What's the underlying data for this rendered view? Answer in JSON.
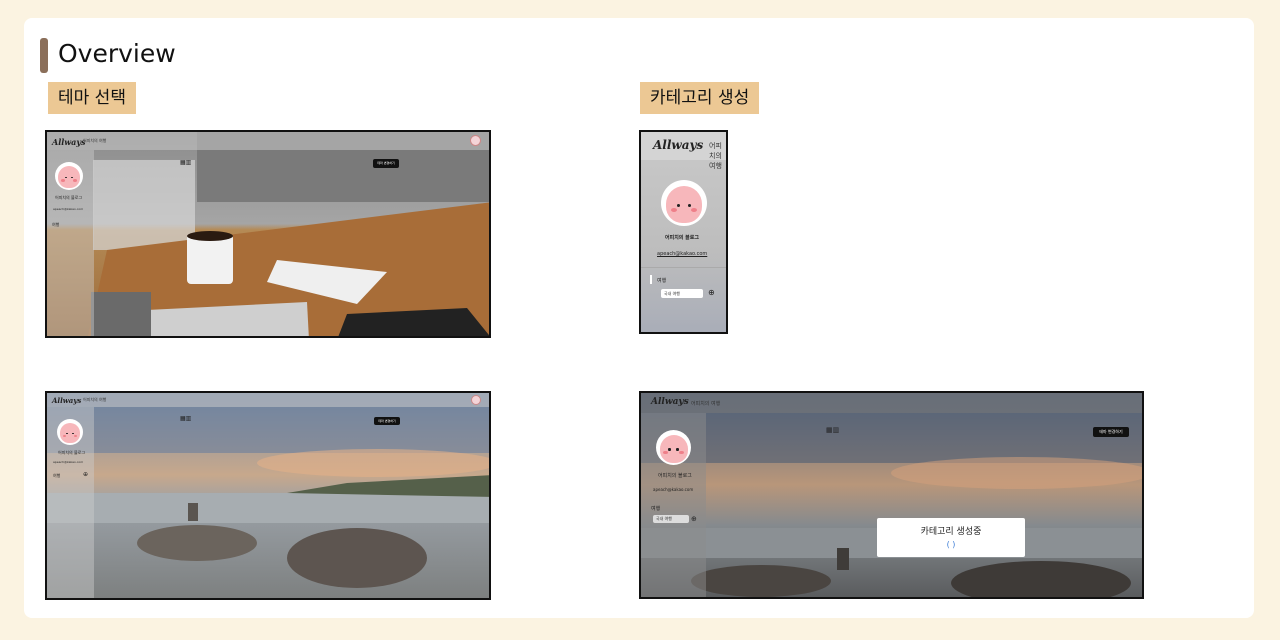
{
  "page": {
    "title": "Overview",
    "accent": "#8b6f5a",
    "tag_color": "#ecc894",
    "background": "#fbf3e1"
  },
  "sections": {
    "theme": {
      "label": "테마 선택"
    },
    "category": {
      "label": "카테고리 생성"
    }
  },
  "mock": {
    "logo": "Allways",
    "blog_name": "어피치의 블로그",
    "email": "apeach@kakao.com",
    "category_header": "여행",
    "category_input_value": "국내 여행",
    "theme_button": "테마 변경하기",
    "loading_text": "카테고리 생성중",
    "loading_spinner": "( )",
    "crumb": "어피치의 여행"
  }
}
